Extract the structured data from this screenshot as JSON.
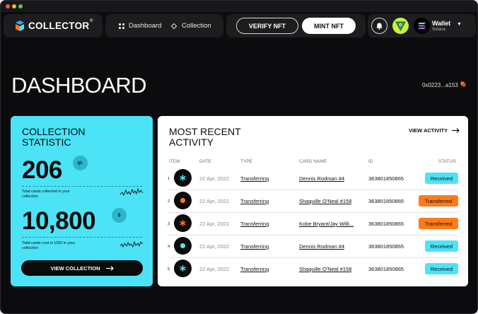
{
  "brand": {
    "name": "COLLECTOR",
    "reg": "®"
  },
  "nav": [
    {
      "label": "Dashboard",
      "icon": "grid-icon"
    },
    {
      "label": "Collection",
      "icon": "diamond-icon"
    }
  ],
  "actions": {
    "verify_label": "VERIFY NFT",
    "mint_label": "MINT NFT"
  },
  "user": {
    "wallet_label": "Wallet",
    "network": "Solana"
  },
  "page": {
    "title": "DASHBOARD",
    "address": "0x0223...a153"
  },
  "stats": {
    "title": "COLLECTION STATISTIC",
    "cards_count": "206",
    "cards_unit": "qt.",
    "cards_desc": "Total cards collected in your collection",
    "cost_value": "10,800",
    "cost_unit": "$",
    "cost_desc": "Total cards cost in USD in your collection",
    "view_label": "VIEW COLLECTION"
  },
  "activity": {
    "title": "MOST RECENT ACTIVITY",
    "view_label": "VIEW ACTIVITY",
    "headers": {
      "item": "ITEM",
      "date": "DATE",
      "type": "TYPE",
      "card_name": "CARD NAME",
      "id": "ID",
      "status": "STATUS"
    },
    "rows": [
      {
        "n": "1",
        "date": "22 Apr, 2022",
        "type": "Transferring",
        "card": "Dennis Rodman #4",
        "id": "363801850865",
        "status": "Received",
        "status_kind": "received",
        "icon_color": "#4ce3f7",
        "icon": "asterisk-icon"
      },
      {
        "n": "2",
        "date": "22 Apr, 2022",
        "type": "Transferring",
        "card": "Shaquille O'Neal #158",
        "id": "363801850865",
        "status": "Transferred",
        "status_kind": "transferred",
        "icon_color": "#ff7a1a",
        "icon": "circle-icon"
      },
      {
        "n": "3",
        "date": "22 Apr, 2022",
        "type": "Transferring",
        "card": "Kobe Bryant/Jay Willi...",
        "id": "363801850865",
        "status": "Transferred",
        "status_kind": "transferred",
        "icon_color": "#ff7a1a",
        "icon": "asterisk-icon"
      },
      {
        "n": "4",
        "date": "22 Apr, 2022",
        "type": "Transferring",
        "card": "Dennis Rodman #4",
        "id": "363801850865",
        "status": "Received",
        "status_kind": "received",
        "icon_color": "#4ce3f7",
        "icon": "circle-icon"
      },
      {
        "n": "5",
        "date": "22 Apr, 2022",
        "type": "Transferring",
        "card": "Shaquille O'Neal #158",
        "id": "363801850865",
        "status": "Received",
        "status_kind": "received",
        "icon_color": "#4ce3f7",
        "icon": "asterisk-icon"
      }
    ]
  },
  "colors": {
    "accent_cyan": "#4ce3f7",
    "accent_orange": "#ff7a1a",
    "background": "#0c0c0e"
  }
}
